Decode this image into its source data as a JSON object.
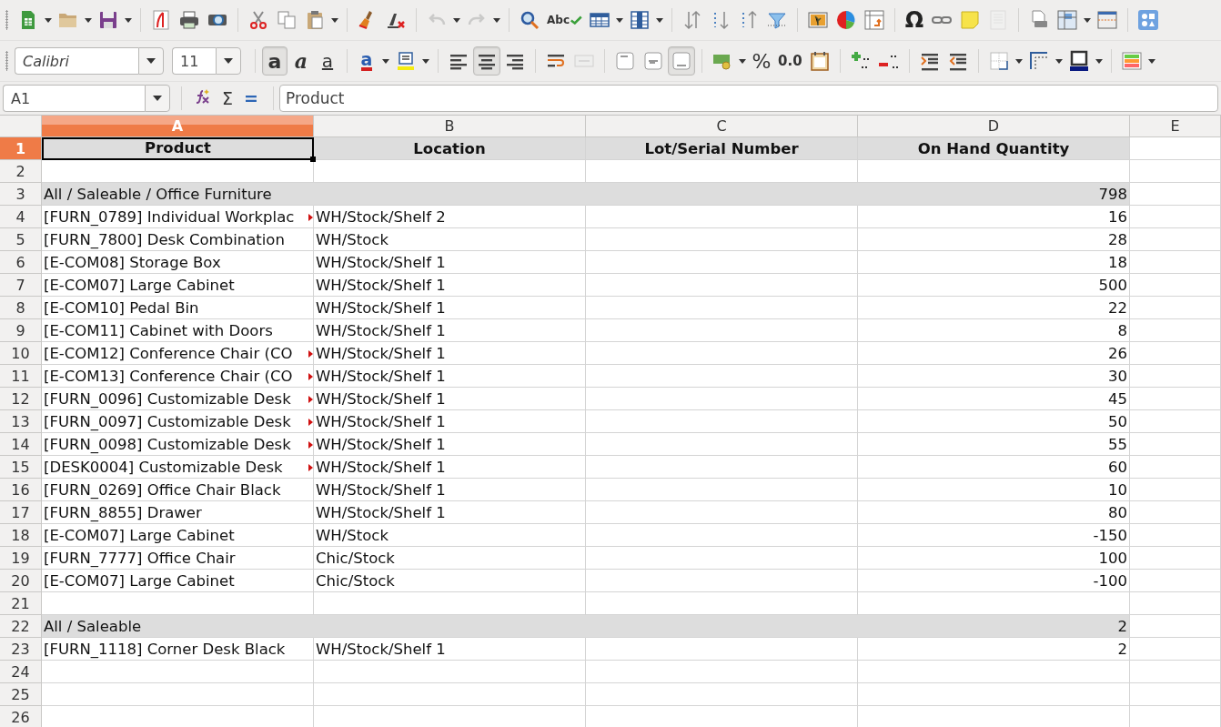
{
  "toolbar_standard": [
    {
      "kind": "new",
      "dropdown": true,
      "disabled": false
    },
    {
      "kind": "open",
      "dropdown": true,
      "disabled": false
    },
    {
      "kind": "save",
      "dropdown": true,
      "disabled": false
    },
    {
      "kind": "sep"
    },
    {
      "kind": "pdf",
      "disabled": false
    },
    {
      "kind": "print",
      "disabled": false
    },
    {
      "kind": "preview",
      "disabled": false
    },
    {
      "kind": "sep"
    },
    {
      "kind": "cut",
      "disabled": false
    },
    {
      "kind": "copy",
      "disabled": false
    },
    {
      "kind": "paste",
      "dropdown": true,
      "disabled": false
    },
    {
      "kind": "sep"
    },
    {
      "kind": "clone",
      "disabled": false
    },
    {
      "kind": "clear",
      "disabled": false
    },
    {
      "kind": "sep"
    },
    {
      "kind": "undo",
      "dropdown": true,
      "disabled": true
    },
    {
      "kind": "redo",
      "dropdown": true,
      "disabled": true
    },
    {
      "kind": "sep"
    },
    {
      "kind": "find",
      "disabled": false
    },
    {
      "kind": "spell",
      "label": "Abc",
      "disabled": false
    },
    {
      "kind": "rows",
      "dropdown": true,
      "disabled": false
    },
    {
      "kind": "cols",
      "dropdown": true,
      "disabled": false
    },
    {
      "kind": "sep"
    },
    {
      "kind": "sort",
      "disabled": false
    },
    {
      "kind": "sortasc",
      "disabled": false
    },
    {
      "kind": "sortdesc",
      "disabled": false
    },
    {
      "kind": "filter",
      "disabled": false
    },
    {
      "kind": "sep"
    },
    {
      "kind": "image",
      "disabled": false
    },
    {
      "kind": "chart",
      "disabled": false
    },
    {
      "kind": "pivot",
      "disabled": false
    },
    {
      "kind": "sep"
    },
    {
      "kind": "special-char",
      "label": "Ω",
      "disabled": false
    },
    {
      "kind": "link",
      "disabled": false
    },
    {
      "kind": "comment",
      "disabled": false
    },
    {
      "kind": "headers",
      "disabled": true
    },
    {
      "kind": "sep"
    },
    {
      "kind": "printrange",
      "disabled": false
    },
    {
      "kind": "freeze",
      "dropdown": true,
      "disabled": false
    },
    {
      "kind": "split",
      "disabled": false
    },
    {
      "kind": "sep"
    },
    {
      "kind": "shapes",
      "disabled": false
    }
  ],
  "toolbar_formatting": {
    "font_name": "Calibri",
    "font_size": "11",
    "buttons": [
      {
        "kind": "sep"
      },
      {
        "kind": "bold",
        "label": "a",
        "selected": true,
        "disabled": false
      },
      {
        "kind": "italic",
        "label": "a",
        "selected": false,
        "disabled": false
      },
      {
        "kind": "underline",
        "label": "a",
        "selected": false,
        "disabled": false
      },
      {
        "kind": "sep"
      },
      {
        "kind": "fontcolor",
        "label": "a",
        "dropdown": true,
        "selected": false,
        "disabled": false
      },
      {
        "kind": "highlight",
        "dropdown": true,
        "selected": false,
        "disabled": false
      },
      {
        "kind": "sep"
      },
      {
        "kind": "left",
        "selected": false,
        "disabled": false
      },
      {
        "kind": "center",
        "selected": true,
        "disabled": false
      },
      {
        "kind": "right",
        "selected": false,
        "disabled": false
      },
      {
        "kind": "sep"
      },
      {
        "kind": "wrap",
        "selected": false,
        "disabled": false
      },
      {
        "kind": "merge",
        "selected": false,
        "disabled": true
      },
      {
        "kind": "sep"
      },
      {
        "kind": "top",
        "selected": false,
        "disabled": false
      },
      {
        "kind": "middle",
        "selected": false,
        "disabled": false
      },
      {
        "kind": "bottom",
        "selected": true,
        "disabled": false
      },
      {
        "kind": "sep"
      },
      {
        "kind": "currency",
        "dropdown": true,
        "selected": false,
        "disabled": false
      },
      {
        "kind": "percent",
        "label": "%",
        "selected": false,
        "disabled": false
      },
      {
        "kind": "number",
        "label": "0.0",
        "selected": false,
        "disabled": false
      },
      {
        "kind": "date",
        "selected": false,
        "disabled": false
      },
      {
        "kind": "sep"
      },
      {
        "kind": "adddec",
        "selected": false,
        "disabled": false
      },
      {
        "kind": "deldec",
        "selected": false,
        "disabled": false
      },
      {
        "kind": "sep"
      },
      {
        "kind": "indent",
        "selected": false,
        "disabled": false
      },
      {
        "kind": "outdent",
        "selected": false,
        "disabled": false
      },
      {
        "kind": "sep"
      },
      {
        "kind": "borders",
        "dropdown": true,
        "selected": false,
        "disabled": false
      },
      {
        "kind": "borderstyle",
        "dropdown": true,
        "selected": false,
        "disabled": false
      },
      {
        "kind": "bordercolor",
        "dropdown": true,
        "selected": false,
        "disabled": false
      },
      {
        "kind": "sep"
      },
      {
        "kind": "conditional",
        "dropdown": true,
        "selected": false,
        "disabled": false
      }
    ]
  },
  "formula_bar": {
    "cell_reference": "A1",
    "sum_label": "Σ",
    "equals_label": "=",
    "content": "Product"
  },
  "sheet": {
    "columns": [
      {
        "label": "A",
        "selected": true
      },
      {
        "label": "B",
        "selected": false
      },
      {
        "label": "C",
        "selected": false
      },
      {
        "label": "D",
        "selected": false
      },
      {
        "label": "E",
        "selected": false
      }
    ],
    "rows": [
      {
        "number": "1",
        "selected": true,
        "kind": "header",
        "cells": [
          "Product",
          "Location",
          "Lot/Serial Number",
          "On Hand Quantity"
        ]
      },
      {
        "number": "2",
        "selected": false,
        "kind": "blank",
        "cells": []
      },
      {
        "number": "3",
        "selected": false,
        "kind": "group",
        "cells": [
          "All / Saleable / Office Furniture",
          "",
          "",
          "798"
        ]
      },
      {
        "number": "4",
        "selected": false,
        "kind": "item",
        "clipped": true,
        "cells": [
          "[FURN_0789] Individual Workplac",
          "WH/Stock/Shelf 2",
          "",
          "16"
        ]
      },
      {
        "number": "5",
        "selected": false,
        "kind": "item",
        "cells": [
          "[FURN_7800] Desk Combination",
          "WH/Stock",
          "",
          "28"
        ]
      },
      {
        "number": "6",
        "selected": false,
        "kind": "item",
        "cells": [
          "[E-COM08] Storage Box",
          "WH/Stock/Shelf 1",
          "",
          "18"
        ]
      },
      {
        "number": "7",
        "selected": false,
        "kind": "item",
        "cells": [
          "[E-COM07] Large Cabinet",
          "WH/Stock/Shelf 1",
          "",
          "500"
        ]
      },
      {
        "number": "8",
        "selected": false,
        "kind": "item",
        "cells": [
          "[E-COM10] Pedal Bin",
          "WH/Stock/Shelf 1",
          "",
          "22"
        ]
      },
      {
        "number": "9",
        "selected": false,
        "kind": "item",
        "cells": [
          "[E-COM11] Cabinet with Doors",
          "WH/Stock/Shelf 1",
          "",
          "8"
        ]
      },
      {
        "number": "10",
        "selected": false,
        "kind": "item",
        "clipped": true,
        "cells": [
          "[E-COM12] Conference Chair (CO",
          "WH/Stock/Shelf 1",
          "",
          "26"
        ]
      },
      {
        "number": "11",
        "selected": false,
        "kind": "item",
        "clipped": true,
        "cells": [
          "[E-COM13] Conference Chair (CO",
          "WH/Stock/Shelf 1",
          "",
          "30"
        ]
      },
      {
        "number": "12",
        "selected": false,
        "kind": "item",
        "clipped": true,
        "cells": [
          "[FURN_0096] Customizable Desk",
          "WH/Stock/Shelf 1",
          "",
          "45"
        ]
      },
      {
        "number": "13",
        "selected": false,
        "kind": "item",
        "clipped": true,
        "cells": [
          "[FURN_0097] Customizable Desk",
          "WH/Stock/Shelf 1",
          "",
          "50"
        ]
      },
      {
        "number": "14",
        "selected": false,
        "kind": "item",
        "clipped": true,
        "cells": [
          "[FURN_0098] Customizable Desk",
          "WH/Stock/Shelf 1",
          "",
          "55"
        ]
      },
      {
        "number": "15",
        "selected": false,
        "kind": "item",
        "clipped": true,
        "cells": [
          "[DESK0004] Customizable Desk",
          "WH/Stock/Shelf 1",
          "",
          "60"
        ]
      },
      {
        "number": "16",
        "selected": false,
        "kind": "item",
        "cells": [
          "[FURN_0269] Office Chair Black",
          "WH/Stock/Shelf 1",
          "",
          "10"
        ]
      },
      {
        "number": "17",
        "selected": false,
        "kind": "item",
        "cells": [
          "[FURN_8855] Drawer",
          "WH/Stock/Shelf 1",
          "",
          "80"
        ]
      },
      {
        "number": "18",
        "selected": false,
        "kind": "item",
        "cells": [
          "[E-COM07] Large Cabinet",
          "WH/Stock",
          "",
          "-150"
        ]
      },
      {
        "number": "19",
        "selected": false,
        "kind": "item",
        "cells": [
          "[FURN_7777] Office Chair",
          "Chic/Stock",
          "",
          "100"
        ]
      },
      {
        "number": "20",
        "selected": false,
        "kind": "item",
        "cells": [
          "[E-COM07] Large Cabinet",
          "Chic/Stock",
          "",
          "-100"
        ]
      },
      {
        "number": "21",
        "selected": false,
        "kind": "blank",
        "cells": []
      },
      {
        "number": "22",
        "selected": false,
        "kind": "group",
        "cells": [
          "All / Saleable",
          "",
          "",
          "2"
        ]
      },
      {
        "number": "23",
        "selected": false,
        "kind": "item",
        "cells": [
          "[FURN_1118] Corner Desk Black",
          "WH/Stock/Shelf 1",
          "",
          "2"
        ]
      },
      {
        "number": "24",
        "selected": false,
        "kind": "blank",
        "cells": []
      },
      {
        "number": "25",
        "selected": false,
        "kind": "blank",
        "cells": []
      },
      {
        "number": "26",
        "selected": false,
        "kind": "blank",
        "cells": []
      }
    ]
  }
}
